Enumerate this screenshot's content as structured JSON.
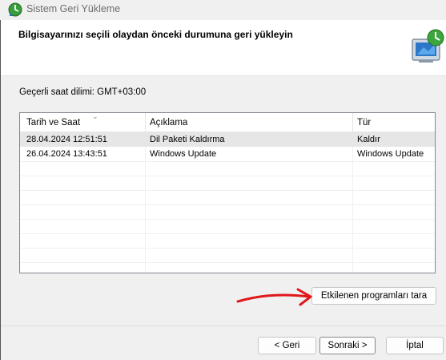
{
  "window": {
    "title": "Sistem Geri Yükleme",
    "header_title": "Bilgisayarınızı seçili olaydan önceki durumuna geri yükleyin",
    "title_icon": "system-restore-icon",
    "header_icon": "restore-computer-icon"
  },
  "timezone_label": "Geçerli saat dilimi: GMT+03:00",
  "table": {
    "columns": [
      "Tarih ve Saat",
      "Açıklama",
      "Tür"
    ],
    "rows": [
      {
        "date": "28.04.2024 12:51:51",
        "description": "Dil Paketi Kaldırma",
        "type": "Kaldır"
      },
      {
        "date": "26.04.2024 13:43:51",
        "description": "Windows Update",
        "type": "Windows Update"
      }
    ],
    "selected_row": 0
  },
  "buttons": {
    "scan": "Etkilenen programları tara",
    "back": "< Geri",
    "next": "Sonraki >",
    "cancel": "İptal"
  },
  "colors": {
    "annotation": "#e0171b",
    "selection": "#e6e6e6"
  }
}
